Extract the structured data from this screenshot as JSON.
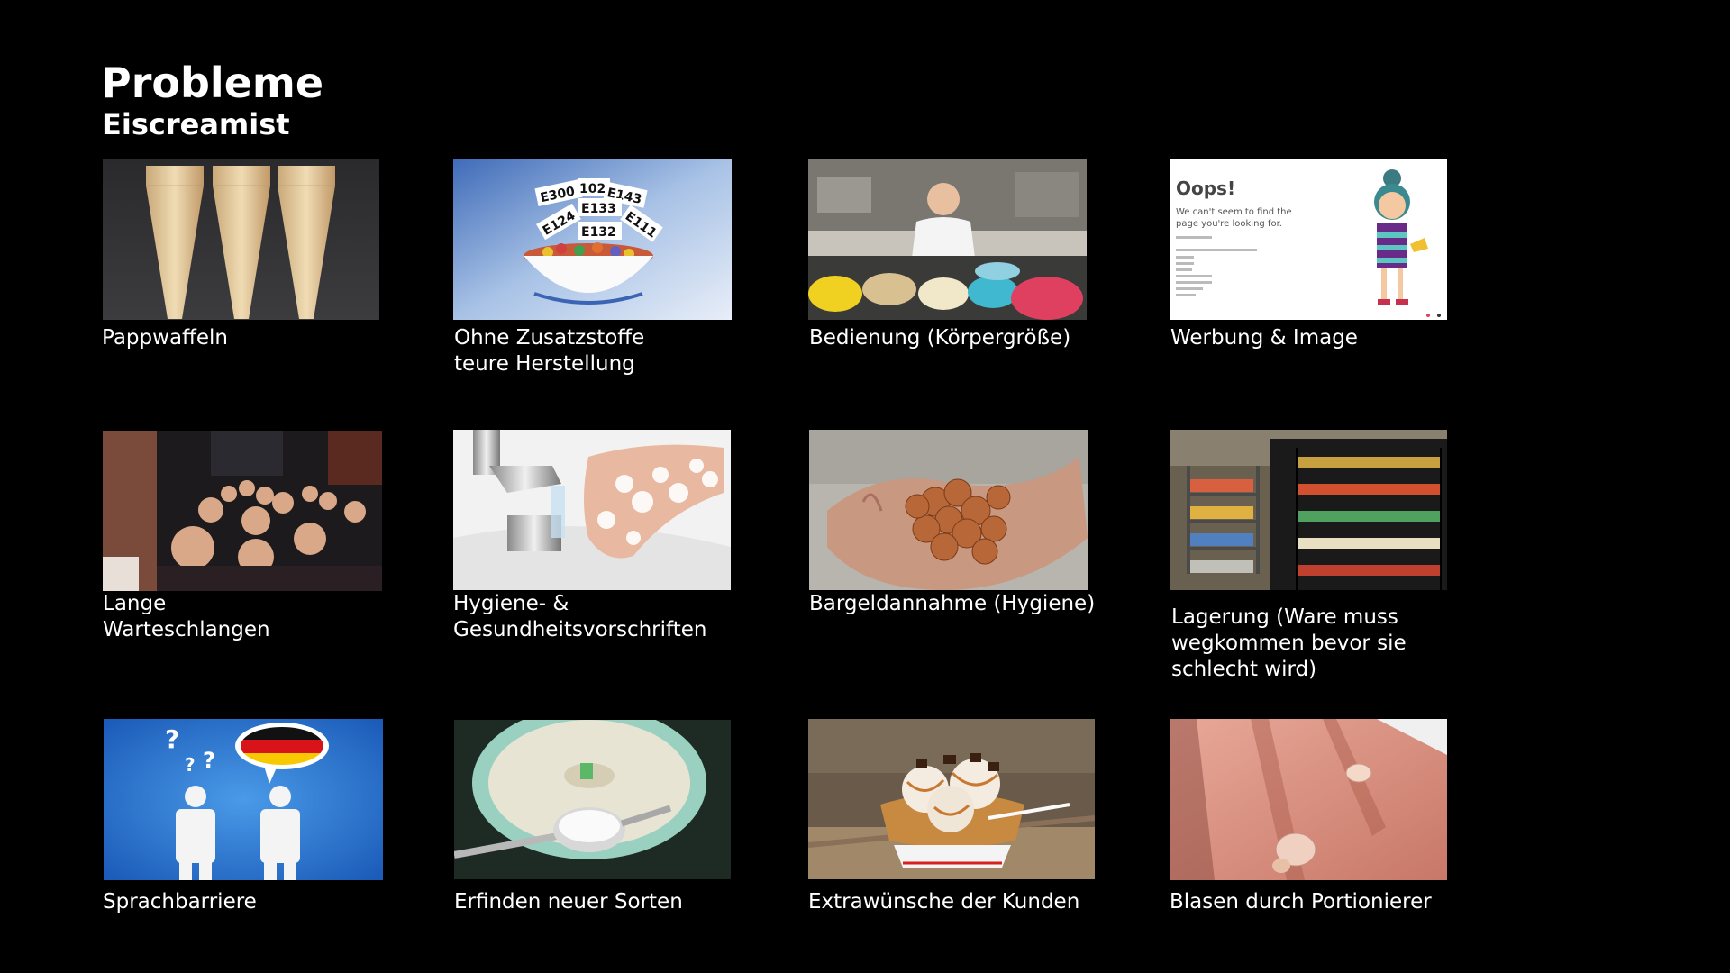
{
  "slide": {
    "title": "Probleme",
    "subtitle": "Eiscreamist"
  },
  "tiles": [
    {
      "caption": "Pappwaffeln",
      "icon": "ice-cream-cones-image"
    },
    {
      "caption": "Ohne Zusatzstoffe\nteure Herstellung",
      "icon": "additives-bowl-image",
      "image_text": [
        "E300",
        "102",
        "E143",
        "E133",
        "E124",
        "E111",
        "E132"
      ]
    },
    {
      "caption": "Bedienung (Körpergröße)",
      "icon": "ice-cream-counter-image"
    },
    {
      "caption": "Werbung & Image",
      "icon": "error-page-image",
      "image_text": {
        "heading": "Oops!",
        "line1": "We can't seem to find the",
        "line2": "page you're looking for."
      }
    },
    {
      "caption": "Lange\nWarteschlangen",
      "icon": "crowd-queue-image"
    },
    {
      "caption": "Hygiene- &\nGesundheitsvorschriften",
      "icon": "hand-washing-image"
    },
    {
      "caption": "Bargeldannahme (Hygiene)",
      "icon": "coins-in-hand-image"
    },
    {
      "caption": "Lagerung (Ware muss\nwegkommen bevor sie\nschlecht wird)",
      "icon": "storage-shelves-image"
    },
    {
      "caption": "Sprachbarriere",
      "icon": "language-barrier-image"
    },
    {
      "caption": "Erfinden  neuer Sorten",
      "icon": "new-flavors-image"
    },
    {
      "caption": "Extrawünsche der Kunden",
      "icon": "ice-cream-sundae-image"
    },
    {
      "caption": "Blasen durch Portionierer",
      "icon": "blistered-hand-image"
    }
  ],
  "colors": {
    "background": "#000000",
    "text": "#ffffff"
  }
}
